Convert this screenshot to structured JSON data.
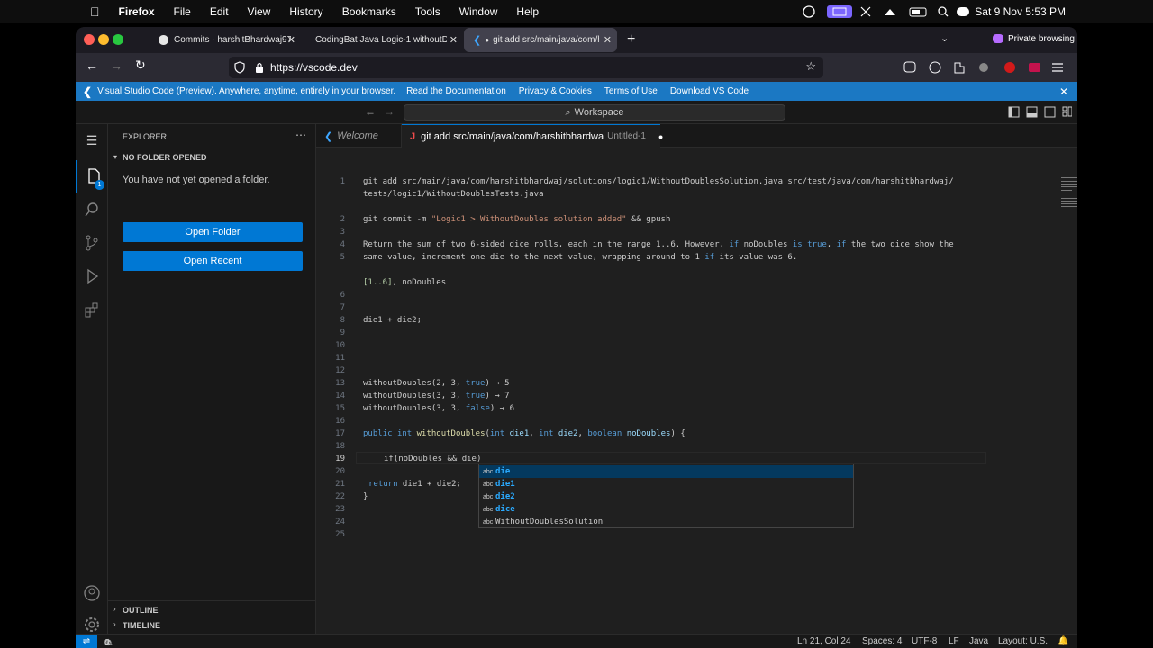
{
  "macos_menu": {
    "app_name": "Firefox",
    "items": [
      "File",
      "Edit",
      "View",
      "History",
      "Bookmarks",
      "Tools",
      "Window",
      "Help"
    ],
    "clock": "Sat 9 Nov  5:53 PM"
  },
  "browser": {
    "tabs": [
      {
        "label": "Commits · harshitBhardwaj97/C"
      },
      {
        "label": "CodingBat Java Logic-1 withoutDou"
      },
      {
        "label": "git add src/main/java/com/ha"
      }
    ],
    "private_label": "Private browsing",
    "url": "https://vscode.dev"
  },
  "infobar": {
    "message": "Visual Studio Code (Preview). Anywhere, anytime, entirely in your browser.",
    "links": [
      "Read the Documentation",
      "Privacy & Cookies",
      "Terms of Use",
      "Download VS Code"
    ]
  },
  "vscode": {
    "command_center": "Workspace",
    "sidebar": {
      "title": "EXPLORER",
      "section": "NO FOLDER OPENED",
      "message": "You have not yet opened a folder.",
      "open_folder": "Open Folder",
      "open_recent": "Open Recent",
      "outline": "OUTLINE",
      "timeline": "TIMELINE",
      "badge": "1"
    },
    "editor_tabs": {
      "welcome": "Welcome",
      "active": "git add src/main/java/com/harshitbhardwa",
      "active_hint": "Untitled-1"
    },
    "line_numbers": [
      "1",
      "",
      "2",
      "3",
      "4",
      "5",
      "",
      "6",
      "7",
      "8",
      "9",
      "10",
      "11",
      "12",
      "13",
      "14",
      "15",
      "16",
      "17",
      "18",
      "19",
      "20",
      "21",
      "22",
      "23",
      "24",
      "25"
    ],
    "lines": {
      "l1a": "git add src/main/java/com/harshitbhardwaj/solutions/logic1/WithoutDoublesSolution.java src/test/java/com/harshitbhardwaj/",
      "l1b": "tests/logic1/WithoutDoublesTests.java",
      "l3a": "git commit -m ",
      "l3b": "\"Logic1 > WithoutDoubles solution added\"",
      "l3c": " && gpush",
      "l5a": "Return the sum of two 6-sided dice rolls, each in the range 1..6. However, ",
      "l5b": "if",
      "l5c": " noDoubles ",
      "l5d": "is",
      "l5e": " ",
      "l5f": "true",
      "l5g": ", ",
      "l5h": "if",
      "l5i": " the two dice show the",
      "l5j": "same value, increment one die to the next value, wrapping around to 1 ",
      "l5k": "if",
      "l5l": " its value was 6.",
      "l7a": "[1..6]",
      "l7b": ", noDoubles",
      "l10": "die1 + die2;",
      "l15a": "withoutDoubles(2, 3, ",
      "l15b": "true",
      "l15c": ") → 5",
      "l16a": "withoutDoubles(3, 3, ",
      "l16b": "true",
      "l16c": ") → 7",
      "l17a": "withoutDoubles(3, 3, ",
      "l17b": "false",
      "l17c": ") → 6",
      "l19kw1": "public",
      "l19kw2": "int",
      "l19fn": "withoutDoubles",
      "l19p1": "int",
      "l19p1n": "die1",
      "l19p2": "int",
      "l19p2n": "die2",
      "l19p3": "boolean",
      "l19p3n": "noDoubles",
      "l21a": "if",
      "l21b": "(noDoubles && die",
      "l21c": ")",
      "l23kw": "return",
      "l23": " die1 + die2;",
      "l24": "}"
    },
    "suggestions": [
      {
        "kind": "abc",
        "match": "die",
        "rest": ""
      },
      {
        "kind": "abc",
        "match": "die",
        "rest": "1"
      },
      {
        "kind": "abc",
        "match": "die",
        "rest": "2"
      },
      {
        "kind": "abc",
        "match": "dice",
        "rest": ""
      },
      {
        "kind": "abc",
        "match": "",
        "rest": "WithoutDoublesSolution"
      }
    ],
    "statusbar": {
      "errors": "0",
      "warnings": "0",
      "position": "Ln 21, Col 24",
      "spaces": "Spaces: 4",
      "encoding": "UTF-8",
      "eol": "LF",
      "language": "Java",
      "layout": "Layout: U.S."
    }
  }
}
